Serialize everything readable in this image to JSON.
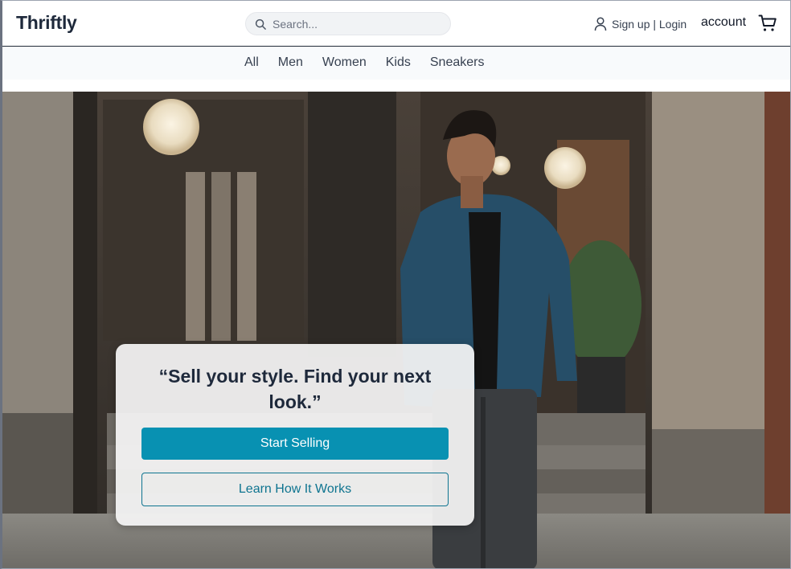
{
  "header": {
    "logo": "Thriftly",
    "search": {
      "placeholder": "Search...",
      "value": ""
    },
    "signin_label": "Sign up | Login",
    "account_label": "account",
    "icons": {
      "search": "search-icon",
      "user": "user-icon",
      "cart": "cart-icon"
    }
  },
  "categories": [
    {
      "label": "All"
    },
    {
      "label": "Men"
    },
    {
      "label": "Women"
    },
    {
      "label": "Kids"
    },
    {
      "label": "Sneakers"
    }
  ],
  "hero": {
    "image": "man-in-denim-shirt-walking-photo",
    "quote": "“Sell your style. Find your next look.”",
    "primary_button": "Start Selling",
    "secondary_button": "Learn How It Works"
  },
  "colors": {
    "accent": "#0891b2",
    "accent_outline": "#0e7490",
    "text_dark": "#1e293b",
    "nav_bg": "#f8fafc"
  }
}
